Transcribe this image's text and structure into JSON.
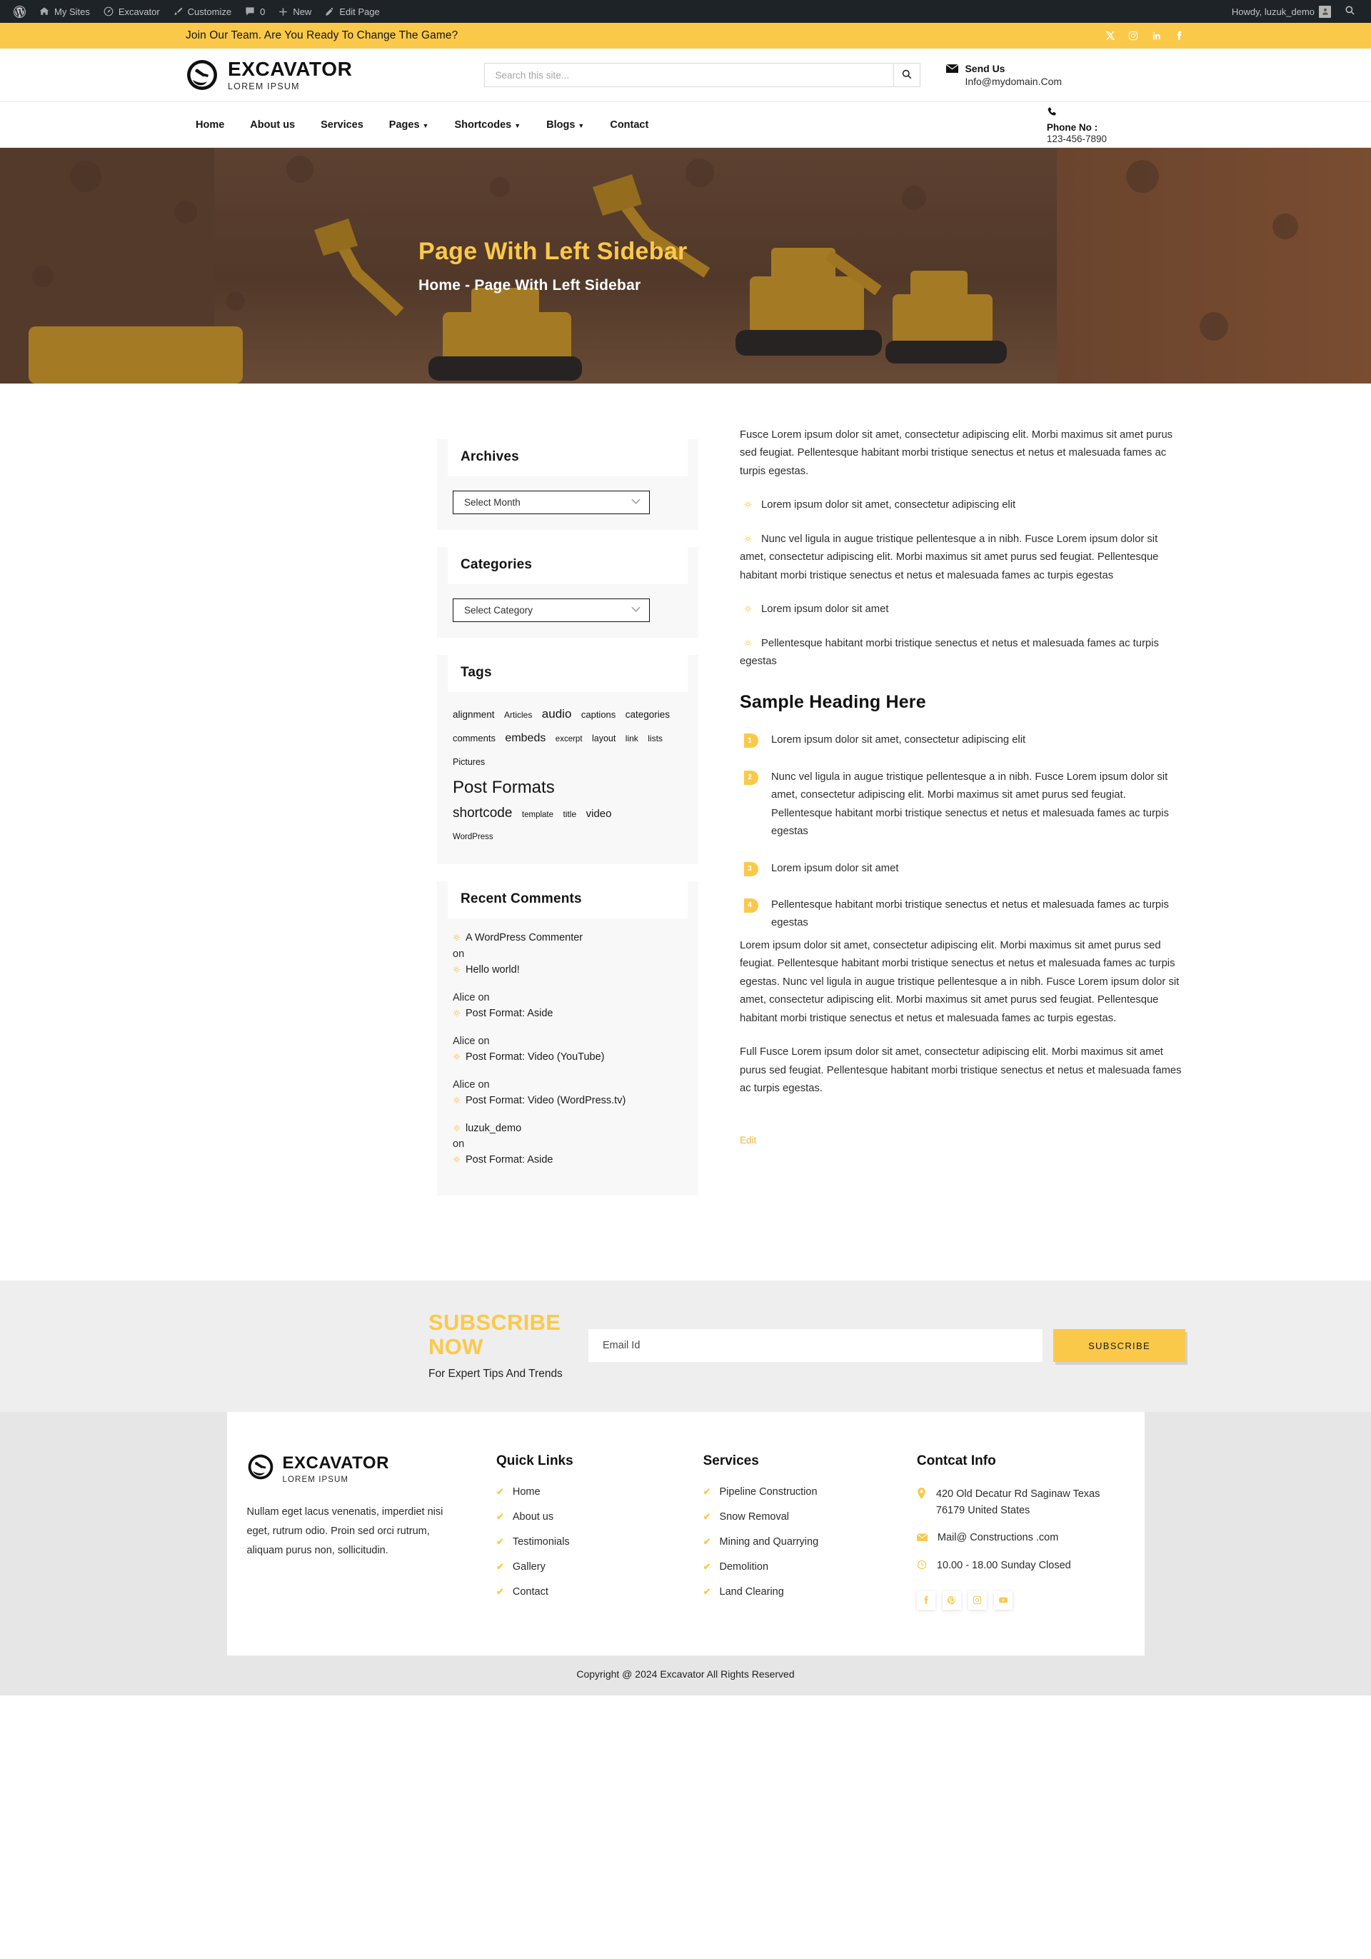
{
  "adminbar": {
    "items": [
      {
        "icon": "wordpress-icon",
        "label": ""
      },
      {
        "icon": "sites-icon",
        "label": "My Sites"
      },
      {
        "icon": "dashboard-icon",
        "label": "Excavator"
      },
      {
        "icon": "brush-icon",
        "label": "Customize"
      },
      {
        "icon": "comment-icon",
        "label": "0"
      },
      {
        "icon": "plus-icon",
        "label": "New"
      },
      {
        "icon": "pencil-icon",
        "label": "Edit Page"
      }
    ],
    "howdy": "Howdy, luzuk_demo",
    "search_icon": "search-icon"
  },
  "topbar": {
    "message": "Join Our Team. Are You Ready To Change The Game?",
    "social": [
      "x-icon",
      "instagram-icon",
      "linkedin-icon",
      "facebook-icon"
    ]
  },
  "header": {
    "brand_name": "EXCAVATOR",
    "brand_sub": "LOREM IPSUM",
    "search_placeholder": "Search this site...",
    "search_value": "",
    "send_us_label": "Send Us",
    "send_us_email": "Info@mydomain.Com",
    "phone_label": "Phone No :",
    "phone_number": "123-456-7890"
  },
  "nav": {
    "items": [
      {
        "label": "Home",
        "has_caret": false
      },
      {
        "label": "About us",
        "has_caret": false
      },
      {
        "label": "Services",
        "has_caret": false
      },
      {
        "label": "Pages",
        "has_caret": true
      },
      {
        "label": "Shortcodes",
        "has_caret": true
      },
      {
        "label": "Blogs",
        "has_caret": true
      },
      {
        "label": "Contact",
        "has_caret": false
      }
    ]
  },
  "hero": {
    "title": "Page With Left Sidebar",
    "breadcrumb": "Home - Page With Left Sidebar"
  },
  "sidebar": {
    "archives": {
      "title": "Archives",
      "select_value": "Select Month"
    },
    "categories": {
      "title": "Categories",
      "select_value": "Select Category"
    },
    "tags": {
      "title": "Tags",
      "items": [
        {
          "label": "alignment",
          "size": 13.5
        },
        {
          "label": "Articles",
          "size": 12
        },
        {
          "label": "audio",
          "size": 17
        },
        {
          "label": "captions",
          "size": 13
        },
        {
          "label": "categories",
          "size": 13.5
        },
        {
          "label": "comments",
          "size": 13
        },
        {
          "label": "embeds",
          "size": 16
        },
        {
          "label": "excerpt",
          "size": 11.5
        },
        {
          "label": "layout",
          "size": 12.5
        },
        {
          "label": "link",
          "size": 12
        },
        {
          "label": "lists",
          "size": 12
        },
        {
          "label": "Pictures",
          "size": 12.5
        },
        {
          "label": "Post Formats",
          "size": 24
        },
        {
          "label": "shortcode",
          "size": 19
        },
        {
          "label": "template",
          "size": 11.5
        },
        {
          "label": "title",
          "size": 12
        },
        {
          "label": "video",
          "size": 15
        },
        {
          "label": "WordPress",
          "size": 11.5
        }
      ]
    },
    "recent_comments": {
      "title": "Recent Comments",
      "items": [
        {
          "author": "A WordPress Commenter",
          "author_is_link": true,
          "on": "on",
          "post": "Hello world!"
        },
        {
          "author": "Alice",
          "author_is_link": false,
          "on": "on",
          "post": "Post Format: Aside"
        },
        {
          "author": "Alice",
          "author_is_link": false,
          "on": "on",
          "post": "Post Format: Video (YouTube)"
        },
        {
          "author": "Alice",
          "author_is_link": false,
          "on": "on",
          "post": "Post Format: Video (WordPress.tv)"
        },
        {
          "author": "luzuk_demo",
          "author_is_link": true,
          "on": "on",
          "post": "Post Format: Aside"
        }
      ]
    }
  },
  "content": {
    "intro": "Fusce Lorem ipsum dolor sit amet, consectetur adipiscing elit. Morbi maximus sit amet purus sed feugiat. Pellentesque habitant morbi tristique senectus et netus et malesuada fames ac turpis egestas.",
    "bullets": [
      "Lorem ipsum dolor sit amet, consectetur adipiscing elit",
      "Nunc vel ligula in augue tristique pellentesque a in nibh. Fusce Lorem ipsum dolor sit amet, consectetur adipiscing elit. Morbi maximus sit amet purus sed feugiat. Pellentesque habitant morbi tristique senectus et netus et malesuada fames ac turpis egestas",
      "Lorem ipsum dolor sit amet",
      "Pellentesque habitant morbi tristique senectus et netus et malesuada fames ac turpis egestas"
    ],
    "heading": "Sample Heading Here",
    "numbered": [
      "Lorem ipsum dolor sit amet, consectetur adipiscing elit",
      "Nunc vel ligula in augue tristique pellentesque a in nibh. Fusce Lorem ipsum dolor sit amet, consectetur adipiscing elit. Morbi maximus sit amet purus sed feugiat. Pellentesque habitant morbi tristique senectus et netus et malesuada fames ac turpis egestas",
      "Lorem ipsum dolor sit amet",
      "Pellentesque habitant morbi tristique senectus et netus et malesuada fames ac turpis egestas"
    ],
    "para_2": "Lorem ipsum dolor sit amet, consectetur adipiscing elit. Morbi maximus sit amet purus sed feugiat. Pellentesque habitant morbi tristique senectus et netus et malesuada fames ac turpis egestas. Nunc vel ligula in augue tristique pellentesque a in nibh. Fusce Lorem ipsum dolor sit amet, consectetur adipiscing elit. Morbi maximus sit amet purus sed feugiat. Pellentesque habitant morbi tristique senectus et netus et malesuada fames ac turpis egestas.",
    "para_3": "Full Fusce Lorem ipsum dolor sit amet, consectetur adipiscing elit. Morbi maximus sit amet purus sed feugiat. Pellentesque habitant morbi tristique senectus et netus et malesuada fames ac turpis egestas.",
    "edit_label": "Edit"
  },
  "subscribe": {
    "title": "SUBSCRIBE NOW",
    "subtitle": "For Expert Tips And Trends",
    "placeholder": "Email Id",
    "value": "",
    "button": "SUBSCRIBE"
  },
  "footer": {
    "brand_name": "EXCAVATOR",
    "brand_sub": "LOREM IPSUM",
    "about": "Nullam eget lacus venenatis, imperdiet nisi eget, rutrum odio. Proin sed orci rutrum, aliquam purus non, sollicitudin.",
    "quick_links": {
      "title": "Quick Links",
      "items": [
        "Home",
        "About us",
        "Testimonials",
        "Gallery",
        "Contact"
      ]
    },
    "services": {
      "title": "Services",
      "items": [
        "Pipeline Construction",
        "Snow Removal",
        "Mining and Quarrying",
        "Demolition",
        "Land Clearing"
      ]
    },
    "contact": {
      "title": "Contcat Info",
      "address": "420 Old Decatur Rd Saginaw Texas 76179 United States",
      "email": "Mail@ Constructions .com",
      "hours": "10.00 - 18.00 Sunday Closed",
      "social": [
        "facebook-icon",
        "pinterest-icon",
        "instagram-icon",
        "youtube-icon"
      ]
    }
  },
  "copyright": "Copyright @ 2024 Excavator All Rights Reserved",
  "colors": {
    "accent": "#fbc94a",
    "adminbar": "#1d2327",
    "subscribe_bg": "#eeeeee",
    "footer_bg": "#e6e6e6"
  }
}
